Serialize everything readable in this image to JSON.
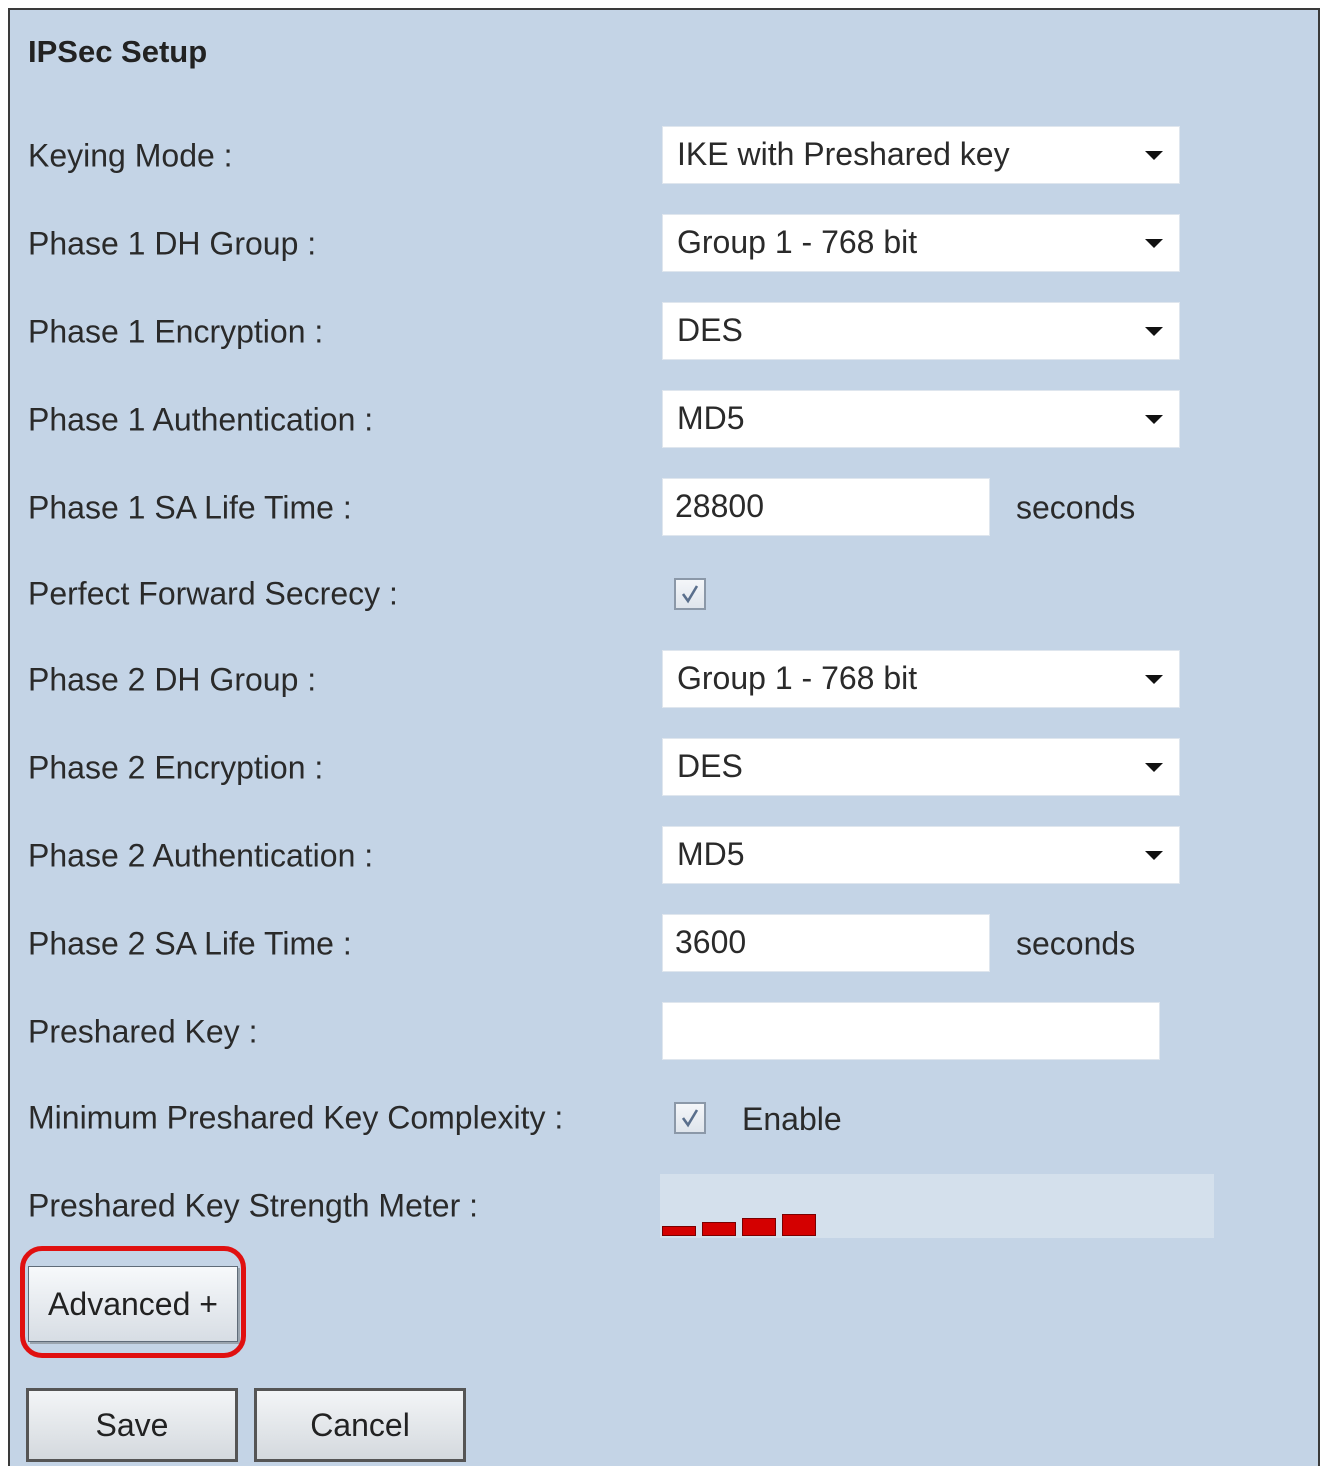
{
  "section": {
    "title": "IPSec Setup"
  },
  "fields": {
    "keying_mode": {
      "label": "Keying Mode :",
      "value": "IKE with Preshared key"
    },
    "p1_dh": {
      "label": "Phase 1 DH Group :",
      "value": "Group 1 - 768 bit"
    },
    "p1_enc": {
      "label": "Phase 1 Encryption :",
      "value": "DES"
    },
    "p1_auth": {
      "label": "Phase 1 Authentication :",
      "value": "MD5"
    },
    "p1_life": {
      "label": "Phase 1 SA Life Time :",
      "value": "28800",
      "unit": "seconds"
    },
    "pfs": {
      "label": "Perfect Forward Secrecy :",
      "checked": true
    },
    "p2_dh": {
      "label": "Phase 2 DH Group :",
      "value": "Group 1 - 768 bit"
    },
    "p2_enc": {
      "label": "Phase 2 Encryption :",
      "value": "DES"
    },
    "p2_auth": {
      "label": "Phase 2 Authentication :",
      "value": "MD5"
    },
    "p2_life": {
      "label": "Phase 2 SA Life Time :",
      "value": "3600",
      "unit": "seconds"
    },
    "psk": {
      "label": "Preshared Key :",
      "value": ""
    },
    "min_complexity": {
      "label": "Minimum Preshared Key Complexity :",
      "checked": true,
      "option_label": "Enable"
    },
    "strength": {
      "label": "Preshared Key Strength Meter :",
      "bars_filled": 4,
      "bars_total": 4,
      "bar_color": "#d40000"
    }
  },
  "buttons": {
    "advanced": "Advanced +",
    "save": "Save",
    "cancel": "Cancel"
  },
  "colors": {
    "panel_bg": "#c4d4e6",
    "highlight": "#e01010"
  }
}
